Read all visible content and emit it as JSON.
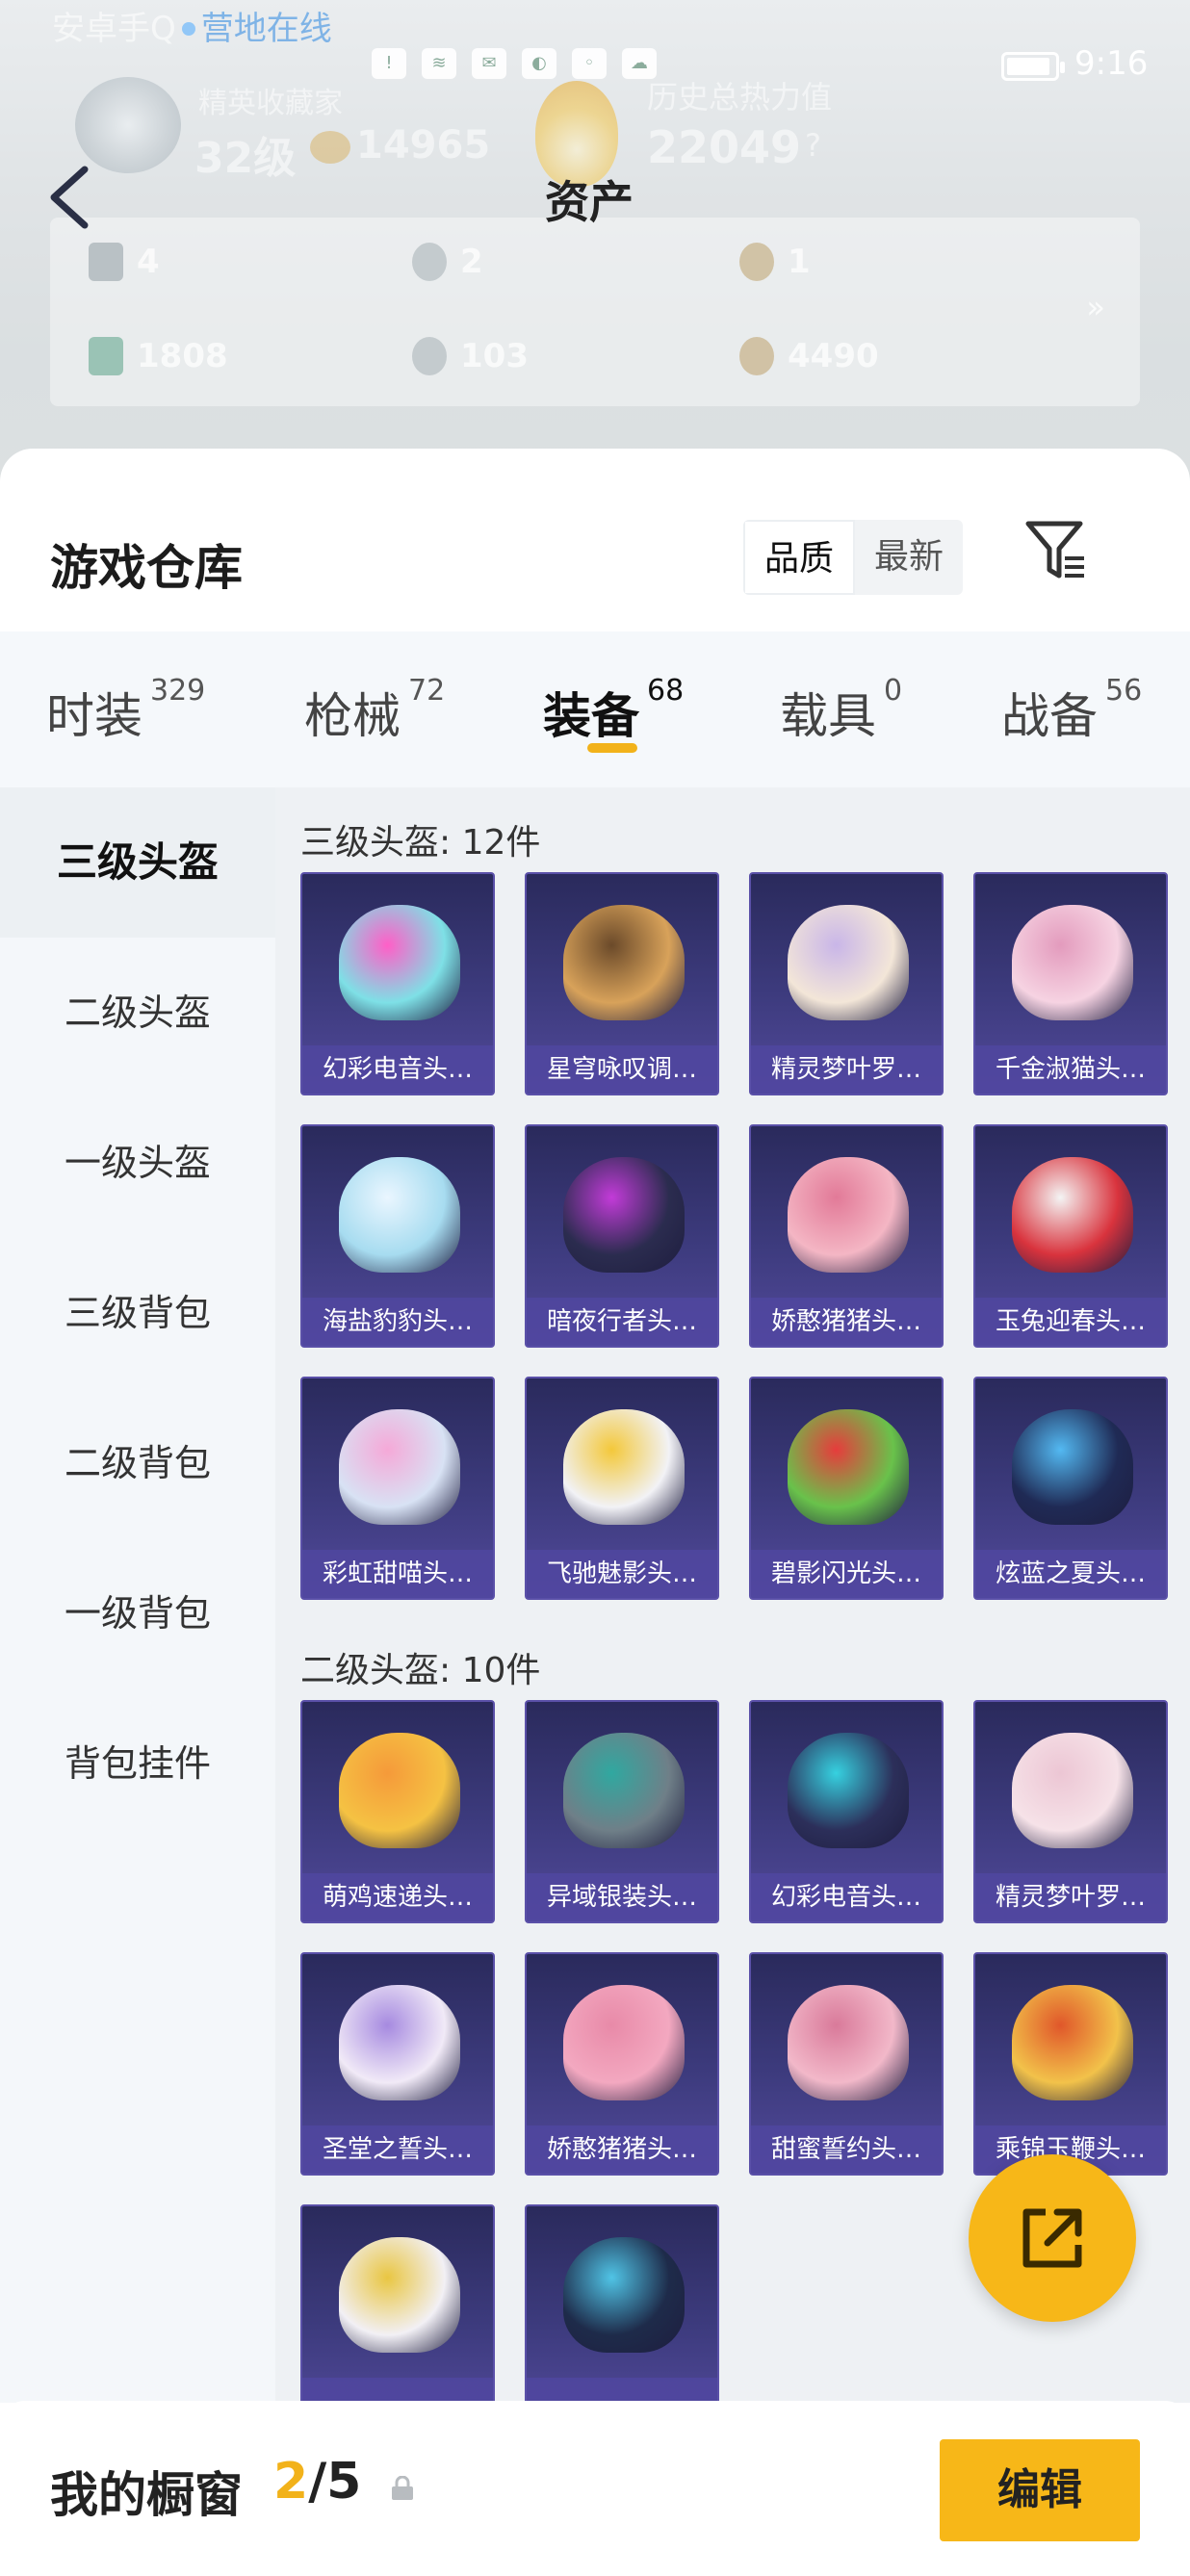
{
  "status_bar": {
    "app_hint": "安卓手Q",
    "online_text": "营地在线",
    "time": "9:16"
  },
  "profile": {
    "rank_title": "精英收藏家",
    "rank_level": "32级",
    "coin_value": "14965",
    "heat_label": "历史总热力值",
    "heat_value": "22049",
    "heat_hint": "?"
  },
  "page_title": "资产",
  "asset_stats": [
    {
      "icon": "card-icon",
      "value": "4"
    },
    {
      "icon": "silver-coin-icon",
      "value": "2"
    },
    {
      "icon": "gold-coin-icon",
      "value": "1"
    },
    {
      "icon": "voucher-icon",
      "value": "1808"
    },
    {
      "icon": "gem-icon",
      "value": "103"
    },
    {
      "icon": "bronze-coin-icon",
      "value": "4490"
    }
  ],
  "asset_more": "»",
  "warehouse": {
    "title": "游戏仓库",
    "sort_options": [
      "品质",
      "最新"
    ],
    "sort_selected": "品质"
  },
  "tabs": [
    {
      "label": "时装",
      "count": "329"
    },
    {
      "label": "枪械",
      "count": "72"
    },
    {
      "label": "装备",
      "count": "68"
    },
    {
      "label": "载具",
      "count": "0"
    },
    {
      "label": "战备",
      "count": "56"
    }
  ],
  "active_tab": "装备",
  "sidebar": [
    "三级头盔",
    "二级头盔",
    "一级头盔",
    "三级背包",
    "二级背包",
    "一级背包",
    "背包挂件"
  ],
  "sidebar_active": "三级头盔",
  "sections": [
    {
      "title": "三级头盔: 12件",
      "items": [
        "幻彩电音头…",
        "星穹咏叹调…",
        "精灵梦叶罗…",
        "千金淑猫头…",
        "海盐豹豹头…",
        "暗夜行者头…",
        "娇憨猪猪头…",
        "玉兔迎春头…",
        "彩虹甜喵头…",
        "飞驰魅影头…",
        "碧影闪光头…",
        "炫蓝之夏头…"
      ]
    },
    {
      "title": "二级头盔: 10件",
      "items": [
        "萌鸡速递头…",
        "异域银装头…",
        "幻彩电音头…",
        "精灵梦叶罗…",
        "圣堂之誓头…",
        "娇憨猪猪头…",
        "甜蜜誓约头…",
        "乘锦玉鞭头…",
        "",
        ""
      ]
    }
  ],
  "colors": {
    "accent": "#f7b718",
    "card_bg": "#3d3b7e",
    "card_caption": "#5046a0"
  },
  "showcase": {
    "label": "我的橱窗",
    "current": "2",
    "total": "/5",
    "edit_label": "编辑"
  }
}
